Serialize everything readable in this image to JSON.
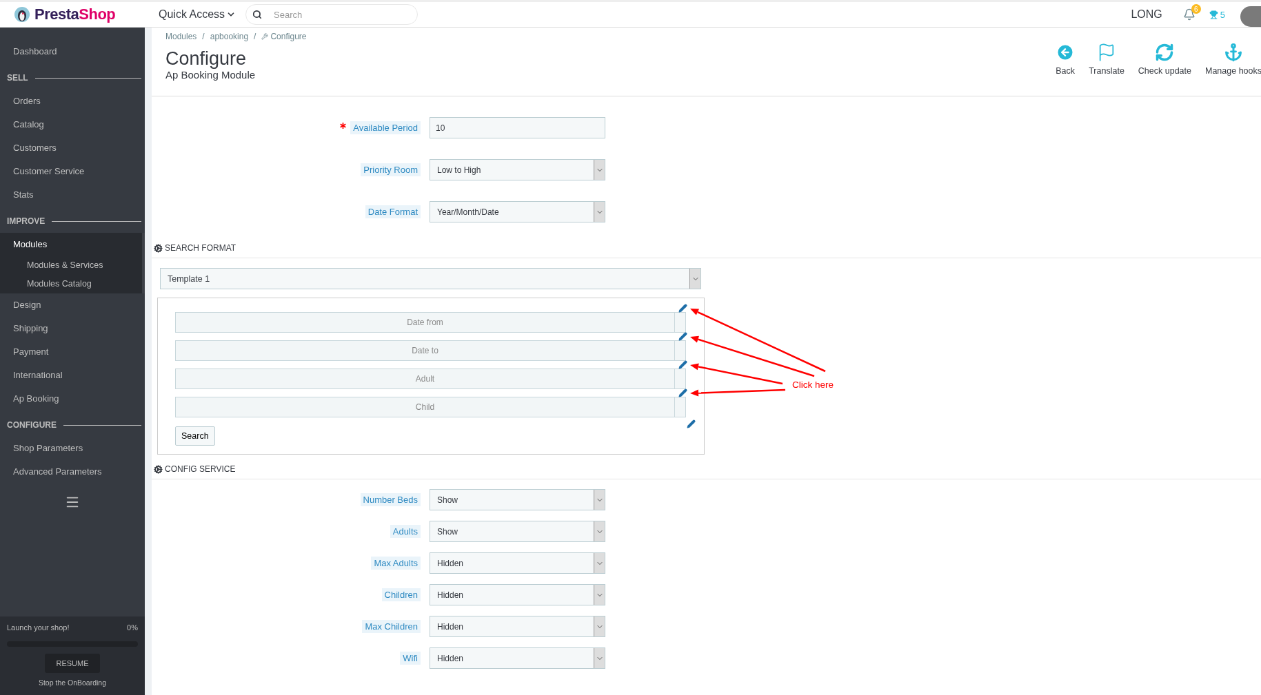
{
  "topbar": {
    "logo_part_1": "Presta",
    "logo_part_2": "Shop",
    "quick_access": "Quick Access",
    "search": {
      "placeholder": "Search"
    },
    "shop": "LONG",
    "notifications": "6",
    "trophies": "5"
  },
  "breadcrumb": [
    "Modules",
    "apbooking",
    "Configure"
  ],
  "breadcrumb_separator": "/",
  "page": {
    "title": "Configure",
    "subtitle": "Ap Booking Module"
  },
  "toolbar": [
    {
      "label": "Back",
      "kind": "back"
    },
    {
      "label": "Translate",
      "kind": "translate"
    },
    {
      "label": "Check update",
      "kind": "update"
    },
    {
      "label": "Manage hooks",
      "kind": "hooks"
    }
  ],
  "sidebar": {
    "items": [
      {
        "kind": "item",
        "label": "Dashboard",
        "selected": false
      },
      {
        "kind": "heading",
        "label": "SELL"
      },
      {
        "kind": "item",
        "label": "Orders",
        "selected": false
      },
      {
        "kind": "item",
        "label": "Catalog",
        "selected": false
      },
      {
        "kind": "item",
        "label": "Customers",
        "selected": false
      },
      {
        "kind": "item",
        "label": "Customer Service",
        "selected": false
      },
      {
        "kind": "item",
        "label": "Stats",
        "selected": false
      },
      {
        "kind": "heading",
        "label": "IMPROVE"
      },
      {
        "kind": "item",
        "label": "Modules",
        "selected": true,
        "children": [
          {
            "label": "Modules & Services",
            "selected": false
          },
          {
            "label": "Modules Catalog",
            "selected": false
          }
        ]
      },
      {
        "kind": "item",
        "label": "Design",
        "selected": false
      },
      {
        "kind": "item",
        "label": "Shipping",
        "selected": false
      },
      {
        "kind": "item",
        "label": "Payment",
        "selected": false
      },
      {
        "kind": "item",
        "label": "International",
        "selected": false
      },
      {
        "kind": "item",
        "label": "Ap Booking",
        "selected": false
      },
      {
        "kind": "heading",
        "label": "CONFIGURE"
      },
      {
        "kind": "item",
        "label": "Shop Parameters",
        "selected": false
      },
      {
        "kind": "item",
        "label": "Advanced Parameters",
        "selected": false
      }
    ]
  },
  "onboarding": {
    "label": "Launch your shop!",
    "percent": "0%",
    "level": 0,
    "button": "RESUME",
    "stop": "Stop the OnBoarding"
  },
  "general_fields": [
    {
      "label": "Available Period",
      "required": true,
      "kind": "text",
      "value": "10"
    },
    {
      "label": "Priority Room",
      "required": false,
      "kind": "select",
      "value": "Low to High"
    },
    {
      "label": "Date Format",
      "required": false,
      "kind": "select",
      "value": "Year/Month/Date"
    }
  ],
  "search_format": {
    "title": "SEARCH FORMAT",
    "template": "Template 1",
    "fields": [
      {
        "placeholder": "Date from"
      },
      {
        "placeholder": "Date to"
      },
      {
        "placeholder": "Adult"
      },
      {
        "placeholder": "Child"
      }
    ],
    "button": "Search"
  },
  "config_service": {
    "title": "CONFIG SERVICE",
    "fields": [
      {
        "label": "Number Beds",
        "required": false,
        "kind": "select",
        "value": "Show"
      },
      {
        "label": "Adults",
        "required": false,
        "kind": "select",
        "value": "Show"
      },
      {
        "label": "Max Adults",
        "required": false,
        "kind": "select",
        "value": "Hidden"
      },
      {
        "label": "Children",
        "required": false,
        "kind": "select",
        "value": "Hidden"
      },
      {
        "label": "Max Children",
        "required": false,
        "kind": "select",
        "value": "Hidden"
      },
      {
        "label": "Wifi",
        "required": false,
        "kind": "select",
        "value": "Hidden"
      }
    ]
  },
  "annotation": {
    "text": "Click here"
  }
}
